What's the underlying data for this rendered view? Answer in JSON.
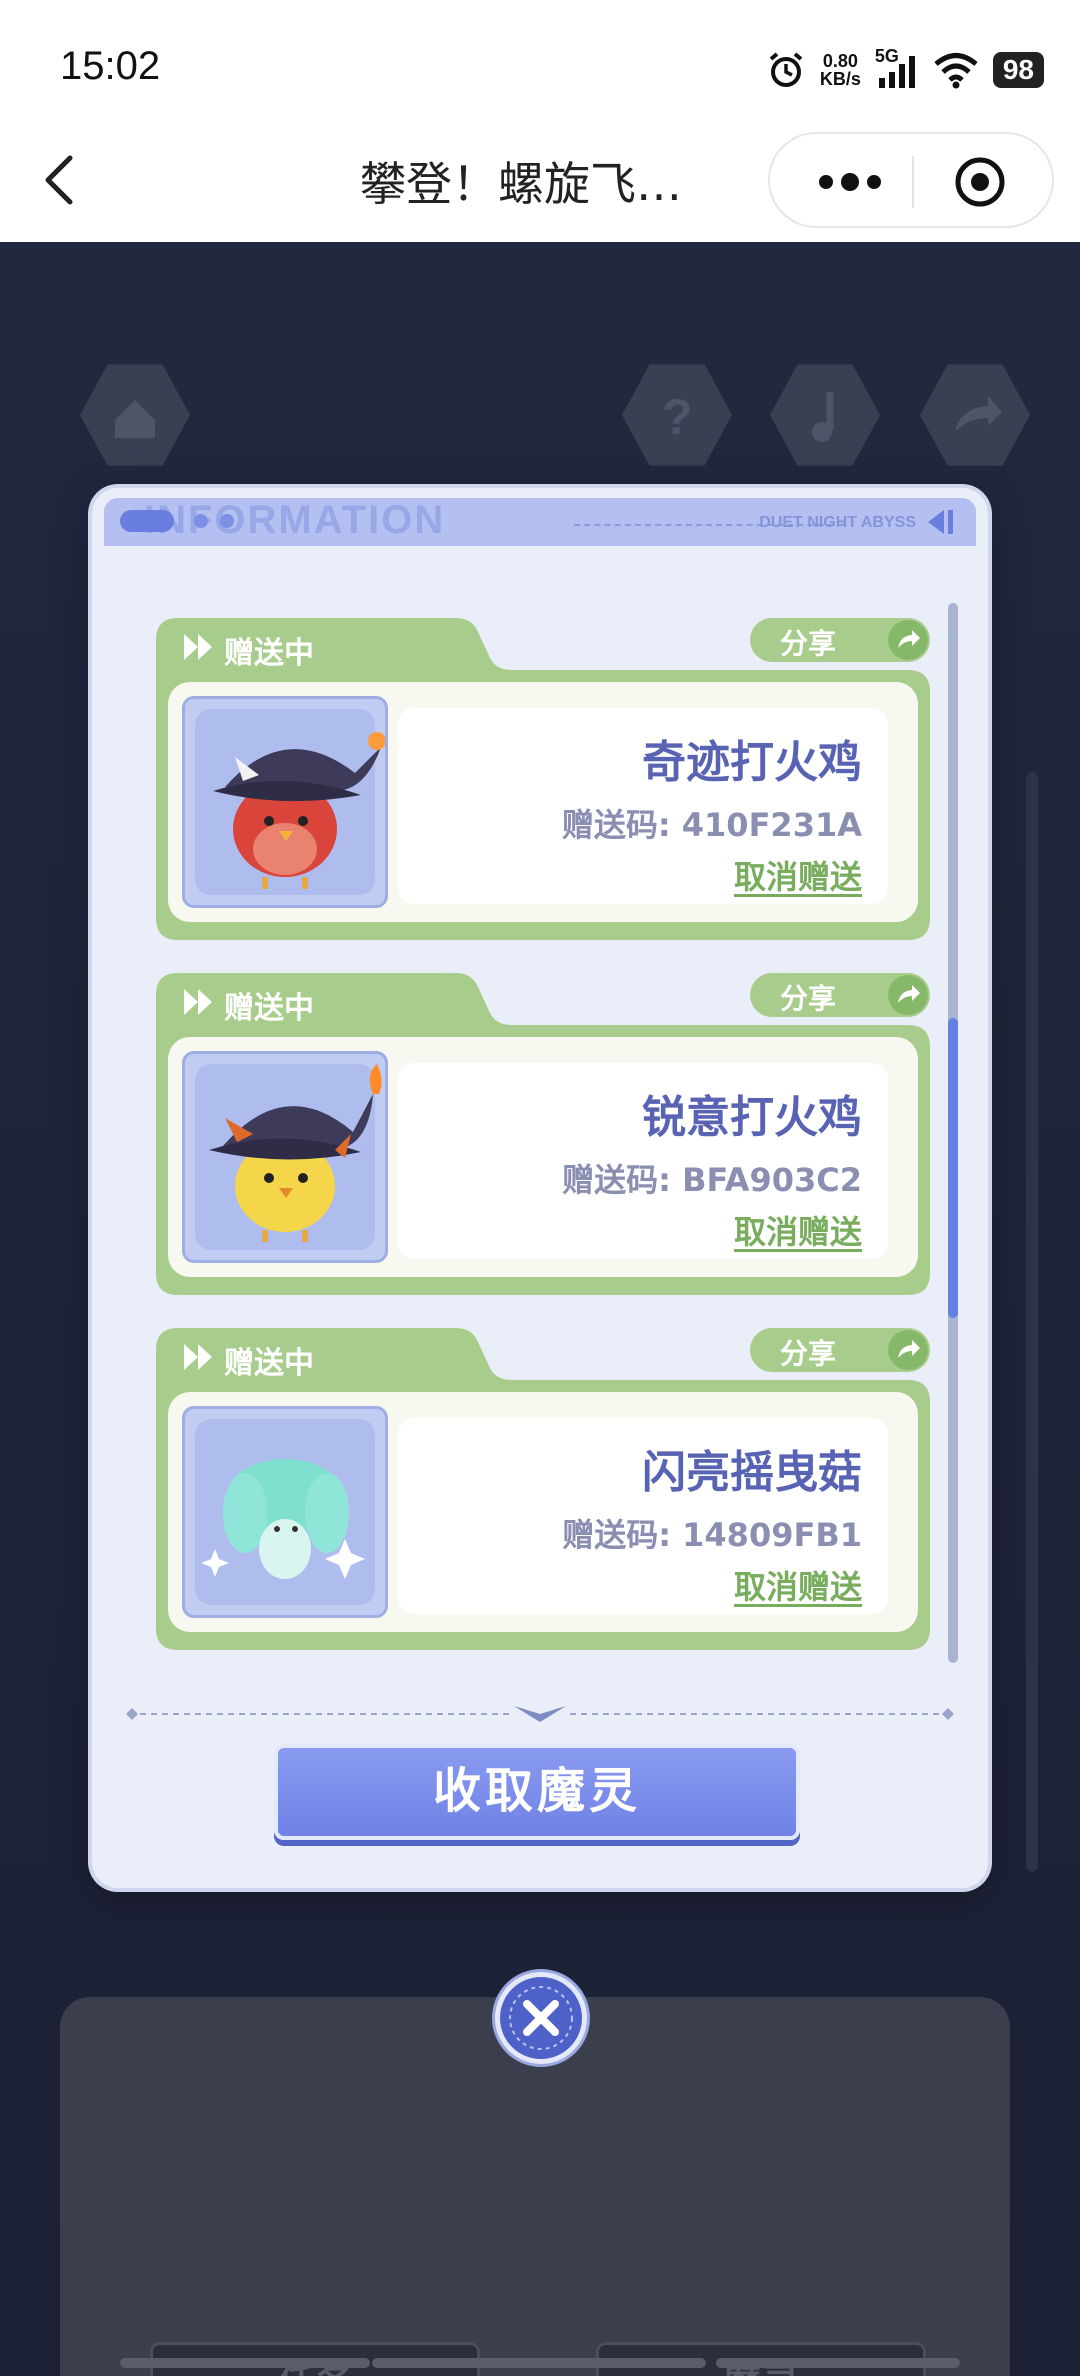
{
  "status_bar": {
    "time": "15:02",
    "net_speed_value": "0.80",
    "net_speed_unit": "KB/s",
    "network": "5G",
    "battery": "98"
  },
  "nav": {
    "title": "攀登！螺旋飞…"
  },
  "modal": {
    "header_watermark": "INFORMATION",
    "header_brand": "DUET NIGHT ABYSS",
    "items": [
      {
        "status": "赠送中",
        "share_label": "分享",
        "name": "奇迹打火鸡",
        "code": "赠送码: 410F231A",
        "cancel_label": "取消赠送"
      },
      {
        "status": "赠送中",
        "share_label": "分享",
        "name": "锐意打火鸡",
        "code": "赠送码: BFA903C2",
        "cancel_label": "取消赠送"
      },
      {
        "status": "赠送中",
        "share_label": "分享",
        "name": "闪亮摇曳菇",
        "code": "赠送码: 14809FB1",
        "cancel_label": "取消赠送"
      }
    ],
    "collect_button": "收取魔灵"
  },
  "background": {
    "tab_task": "任务",
    "tab_spirit": "魔灵"
  },
  "colors": {
    "accent_blue": "#6f82e6",
    "card_green": "#a8cc8c",
    "name_text": "#5963b3"
  }
}
